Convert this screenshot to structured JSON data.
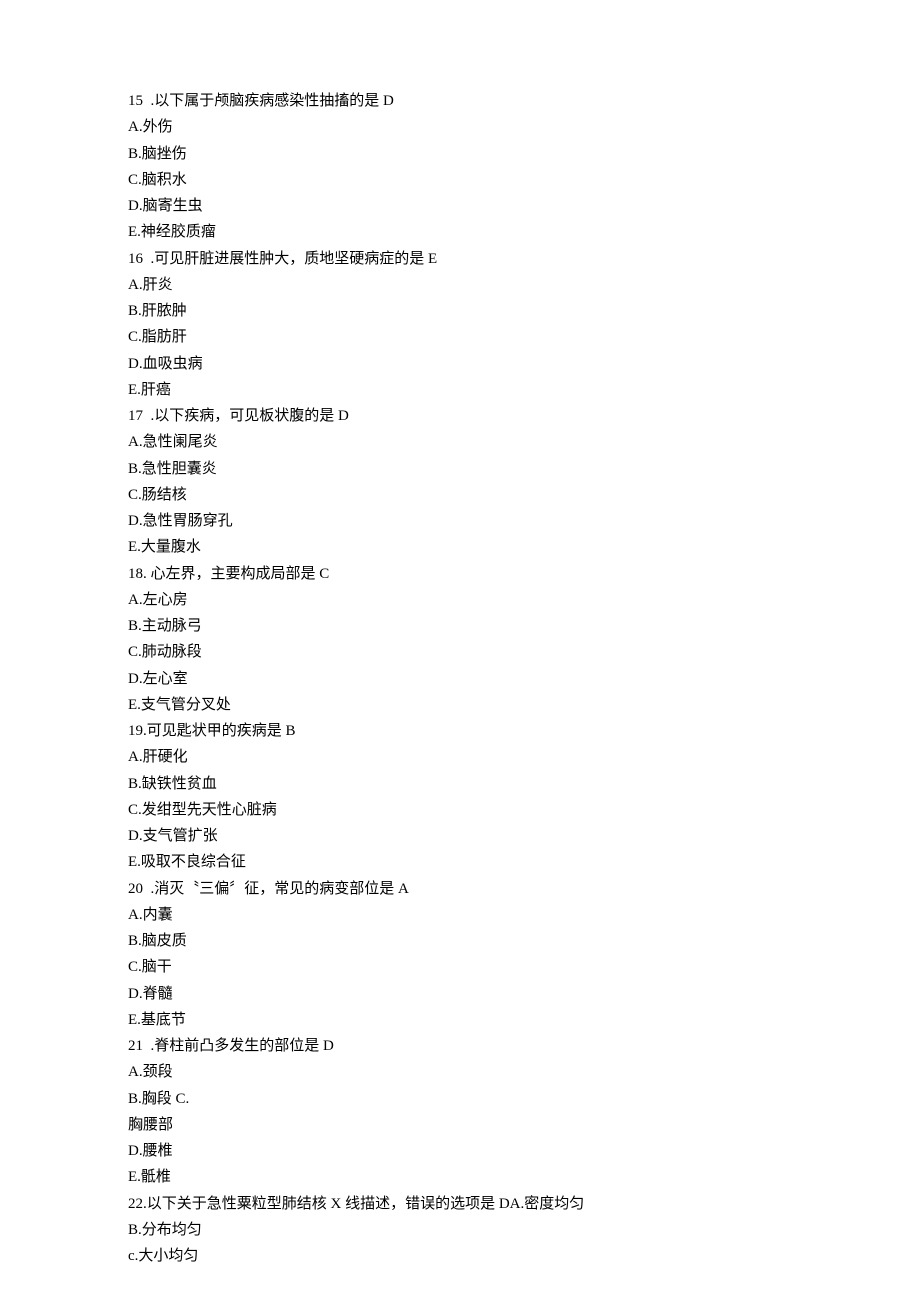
{
  "questions": [
    {
      "stem": "15  .以下属于颅脑疾病感染性抽搐的是 D",
      "options": [
        "A.外伤",
        "B.脑挫伤",
        "C.脑积水",
        "D.脑寄生虫",
        "E.神经胶质瘤"
      ]
    },
    {
      "stem": "16  .可见肝脏进展性肿大，质地坚硬病症的是 E",
      "options": [
        "A.肝炎",
        "B.肝脓肿",
        "C.脂肪肝",
        "D.血吸虫病",
        "E.肝癌"
      ]
    },
    {
      "stem": "17  .以下疾病，可见板状腹的是 D",
      "options": [
        "A.急性阑尾炎",
        "B.急性胆囊炎",
        "C.肠结核",
        "D.急性胃肠穿孔",
        "E.大量腹水"
      ]
    },
    {
      "stem": "18. 心左界，主要构成局部是 C",
      "options": [
        "A.左心房",
        "B.主动脉弓",
        "C.肺动脉段",
        "D.左心室",
        "E.支气管分叉处"
      ]
    },
    {
      "stem": "19.可见匙状甲的疾病是 B",
      "options": [
        "A.肝硬化",
        "B.缺铁性贫血",
        "C.发绀型先天性心脏病",
        "D.支气管扩张",
        "E.吸取不良综合征"
      ]
    },
    {
      "stem": "20  .消灭〝三偏〞征，常见的病变部位是 A",
      "options": [
        "A.内囊",
        "B.脑皮质",
        "C.脑干",
        "D.脊髓",
        "E.基底节"
      ]
    },
    {
      "stem": "21  .脊柱前凸多发生的部位是 D",
      "options": [
        "A.颈段",
        "B.胸段 C.",
        "胸腰部",
        "D.腰椎",
        "E.骶椎"
      ]
    },
    {
      "stem": "22.以下关于急性粟粒型肺结核 X 线描述，错误的选项是 DA.密度均匀",
      "options": [
        "B.分布均匀",
        "c.大小均匀"
      ]
    }
  ]
}
